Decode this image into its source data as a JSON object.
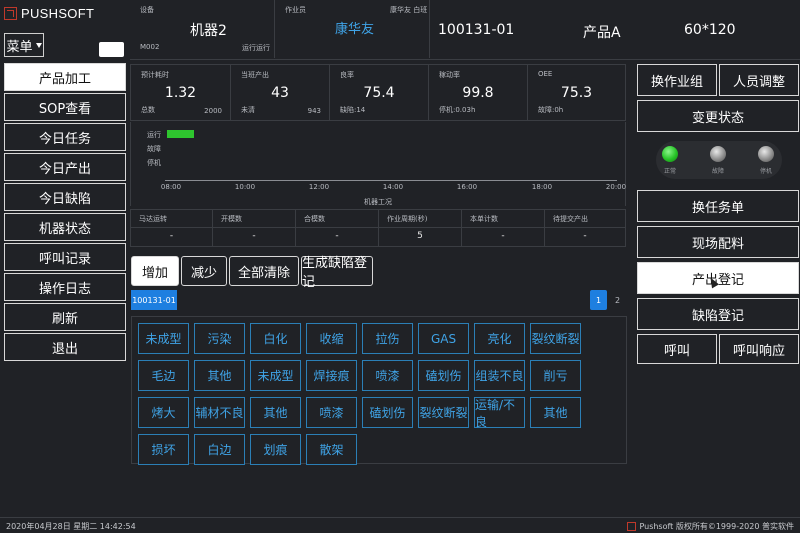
{
  "brand": {
    "name": "PUSHSOFT"
  },
  "menu": {
    "label": "菜单"
  },
  "nav": [
    {
      "label": "产品加工",
      "active": true
    },
    {
      "label": "SOP查看"
    },
    {
      "label": "今日任务"
    },
    {
      "label": "今日产出"
    },
    {
      "label": "今日缺陷"
    },
    {
      "label": "机器状态"
    },
    {
      "label": "呼叫记录"
    },
    {
      "label": "操作日志"
    },
    {
      "label": "刷新"
    },
    {
      "label": "退出"
    }
  ],
  "header": {
    "device_label": "设备",
    "device_name": "机器2",
    "device_code": "M002",
    "device_state": "运行运行",
    "operator_label": "作业员",
    "operator_name": "康华友",
    "operator_name_small": "康华友 白班",
    "order_no": "100131-01",
    "product": "产品A",
    "spec": "60*120"
  },
  "stats": [
    {
      "label": "预计耗时",
      "value": "1.32",
      "sub_left": "总数",
      "sub_right": "2000"
    },
    {
      "label": "当班产出",
      "value": "43",
      "sub_left": "未清",
      "sub_right": "943"
    },
    {
      "label": "良率",
      "value": "75.4",
      "sub_left": "缺陷:14",
      "sub_right": ""
    },
    {
      "label": "稼动率",
      "value": "99.8",
      "sub_left": "停机:0.03h",
      "sub_right": ""
    },
    {
      "label": "OEE",
      "value": "75.3",
      "sub_left": "故障:0h",
      "sub_right": ""
    }
  ],
  "timeline": {
    "rows": [
      "运行",
      "故障",
      "停机"
    ],
    "ticks": [
      "08:00",
      "10:00",
      "12:00",
      "14:00",
      "16:00",
      "18:00",
      "20:00"
    ],
    "title": "机器工况",
    "colors": {
      "run": "#2ec52e"
    }
  },
  "counts": [
    {
      "label": "马达运转",
      "value": "-"
    },
    {
      "label": "开模数",
      "value": "-"
    },
    {
      "label": "合模数",
      "value": "-"
    },
    {
      "label": "作业周期(秒)",
      "value": "5"
    },
    {
      "label": "本单计数",
      "value": "-"
    },
    {
      "label": "待提交产出",
      "value": "-"
    }
  ],
  "actions": [
    {
      "label": "增加"
    },
    {
      "label": "减少"
    },
    {
      "label": "全部清除"
    },
    {
      "label": "生成缺陷登记"
    }
  ],
  "defect_tab": {
    "label": "100131-01"
  },
  "pagination": {
    "pages": [
      "1",
      "2"
    ],
    "current": "1"
  },
  "defects": [
    [
      "未成型",
      "污染",
      "白化",
      "收缩",
      "拉伤",
      "GAS",
      "亮化",
      "裂纹断裂"
    ],
    [
      "毛边",
      "其他",
      "未成型",
      "焊接痕",
      "喷漆",
      "磕划伤",
      "组装不良",
      "削亏"
    ],
    [
      "烤大",
      "辅材不良",
      "其他",
      "喷漆",
      "磕划伤",
      "裂纹断裂",
      "运输/不良",
      "其他"
    ],
    [
      "损坏",
      "白边",
      "划痕",
      "散架"
    ]
  ],
  "right": {
    "change_group": "换作业组",
    "adjust_staff": "人员调整",
    "change_state": "变更状态",
    "lights": [
      {
        "label": "正常",
        "color": "#27c427"
      },
      {
        "label": "故障",
        "color": "#b5b5b5"
      },
      {
        "label": "停机",
        "color": "#b5b5b5"
      }
    ],
    "switch_task": "换任务单",
    "onsite_material": "现场配料",
    "output_register": "产出登记",
    "defect_register": "缺陷登记",
    "call": "呼叫",
    "call_response": "呼叫响应"
  },
  "footer": {
    "datetime": "2020年04月28日 星期二 14:42:54",
    "copyright": "Pushsoft 版权所有©1999-2020 普实软件"
  }
}
